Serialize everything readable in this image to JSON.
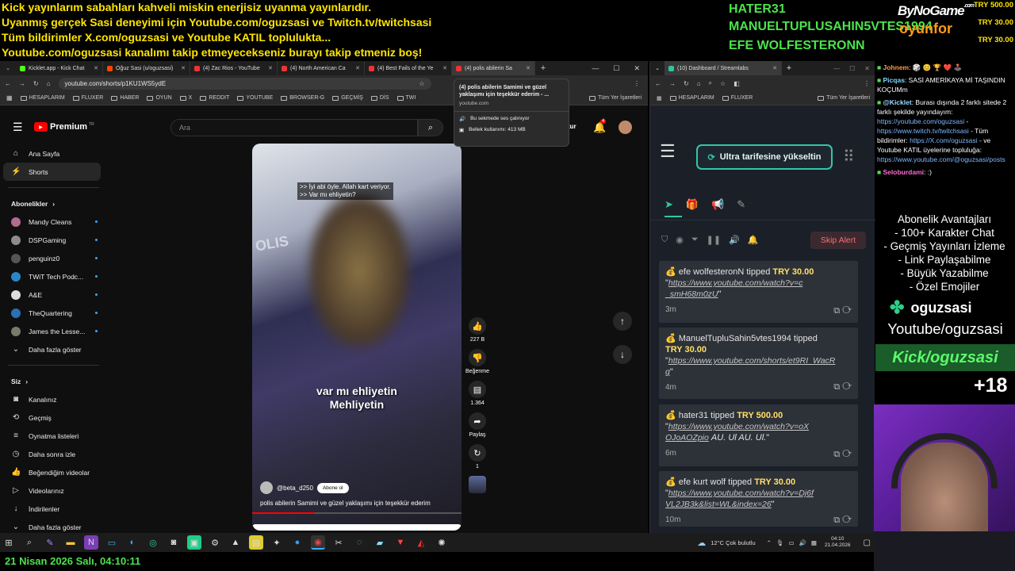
{
  "overlay": {
    "lines": [
      "Kick yayınlarım sabahları kahveli miskin enerjisiz uyanma yayınlarıdır.",
      "Uyanmış gerçek Sasi deneyimi için Youtube.com/oguzsasi ve Twitch.tv/twitchsasi",
      "Tüm bildirimler X.com/oguzsasi ve Youtube KATIL toplulukta...",
      "Youtube.com/oguzsasi kanalımı takip etmeyecekseniz burayı takip etmeniz boş!"
    ],
    "donors": [
      "HATER31",
      "MANUELTUPLUSAHIN5VTES1994",
      "EFE WOLFESTERONN"
    ],
    "logo_main": "ByNoGame",
    "logo_com": ".com",
    "logo_sub": "oyunfor",
    "amounts": [
      "TRY 500.00",
      "TRY 30.00",
      "TRY 30.00"
    ],
    "datetime": "21 Nisan 2026 Salı, 04:10:11",
    "age_badge": "+18"
  },
  "browser_left": {
    "tabs": [
      "Kicklet.app - Kick Chat",
      "Oğuz Sasi (u/oguzsasi)",
      "(4) Zac Rios - YouTube",
      "(4) North American Ca",
      "(4) Best Fails of the Ye",
      "(4) polis abilerin Sa"
    ],
    "url": "youtube.com/shorts/p1KU1WS5ydE",
    "bookmarks": [
      "HESAPLARIM",
      "FLUXER",
      "HABER",
      "OYUN",
      "X",
      "REDDIT",
      "YOUTUBE",
      "BROWSER-G",
      "GEÇMİŞ",
      "DİS",
      "TWI"
    ],
    "all_bookmarks": "Tüm Yer İşaretleri",
    "tooltip": {
      "title": "(4) polis abilerin Samimi ve güzel yaklaşımı için teşekkür ederim - ...",
      "domain": "youtube.com",
      "audio": "Bu sekmede ses çalınıyor",
      "memory": "Bellek kullanımı: 413 MB"
    }
  },
  "youtube": {
    "logo": "Premium",
    "logo_badge": "TR",
    "search_placeholder": "Ara",
    "create_label": "tur",
    "notif_count": "4",
    "nav": [
      "Ana Sayfa",
      "Shorts"
    ],
    "subs_heading": "Abonelikler",
    "subs": [
      "Mandy Cleans",
      "DSPGaming",
      "penguinz0",
      "TWiT Tech Podc...",
      "A&E",
      "TheQuartering",
      "James the Lesse..."
    ],
    "more": "Daha fazla göster",
    "you_heading": "Siz",
    "you_items": [
      "Kanalınız",
      "Geçmiş",
      "Oynatma listeleri",
      "Daha sonra izle",
      "Beğendiğim videolar",
      "Videolarınız",
      "İndirilenler"
    ],
    "more2": "Daha fazla göster",
    "short": {
      "cap1": ">> İyi abi öyle. Allah kart veriyor.",
      "cap2": ">> Var mı ehliyetin?",
      "sub1": "var mı ehliyetin",
      "sub2": "Mehliyetin",
      "channel": "@beta_d250",
      "subscribe": "Abone ol",
      "title": "polis abilerin Samimi ve güzel yaklaşımı için teşekkür ederim",
      "likes": "227 B",
      "dislike": "Beğenme",
      "comments": "1.364",
      "share": "Paylaş",
      "remix": "1"
    }
  },
  "browser_right": {
    "tab": "(10) Dashboard / Streamlabs",
    "bookmarks": [
      "HESAPLARIM",
      "FLUXER"
    ],
    "all_bookmarks": "Tüm Yer İşaretleri",
    "upgrade": "Ultra tarifesine yükseltin",
    "skip_alert": "Skip Alert",
    "alerts": [
      {
        "name": "efe wolfesteronN",
        "verb": "tipped",
        "amount": "TRY 30.00",
        "link": "https://www.youtube.com/watch?v=c_smH68m0zU",
        "msg": "",
        "time": "3m"
      },
      {
        "name": "ManuelTupluSahin5vtes1994",
        "verb": "tipped",
        "amount": "TRY 30.00",
        "link": "https://www.youtube.com/shorts/et9RI_WacRg",
        "msg": "",
        "time": "4m"
      },
      {
        "name": "hater31",
        "verb": "tipped",
        "amount": "TRY 500.00",
        "link": "https://www.youtube.com/watch?v=oXOJoAOZpio",
        "msg": "AU. Ul AU. Ul.",
        "time": "6m"
      },
      {
        "name": "efe kurt wolf",
        "verb": "tipped",
        "amount": "TRY 30.00",
        "link": "https://www.youtube.com/watch?v=Dj6fVL2JB3k&list=WL&index=26",
        "msg": "",
        "time": "10m"
      }
    ]
  },
  "chat": {
    "messages": [
      {
        "user": "Johnem",
        "text": ": 🎲 😊 🏆 ❤️ 🕹️"
      },
      {
        "user": "Picqas",
        "text": ": SASİ AMERİKAYA Mİ TAŞINDIN KOÇUMm"
      },
      {
        "user": "@Kicklet",
        "text": ": Burası dışında 2 farklı sitede 2 farklı şekilde yayındayım:"
      },
      {
        "user": "Seloburdami",
        "text": ": :)"
      }
    ],
    "links": [
      "https://youtube.com/oguzsasi",
      "https://www.twitch.tv/twitchsasi",
      "https://X.com/oguzsasi",
      "https://www.youtube.com/@oguzsasi/posts"
    ],
    "bildirim": "- Tüm bildirimler:",
    "katil": "- ve Youtube KATIL üyelerine topluluğa:"
  },
  "perks": {
    "title": "Abonelik Avantajları",
    "items": [
      "- 100+ Karakter Chat",
      "- Geçmiş Yayınları İzleme",
      "- Link Paylaşabilme",
      "- Büyük Yazabilme",
      "- Özel Emojiler"
    ]
  },
  "socials": {
    "kick_name": "oguzsasi",
    "youtube": "Youtube/oguzsasi",
    "kick": "Kick/oguzsasi"
  },
  "taskbar": {
    "weather": "12°C  Çok bulutlu",
    "time": "04:10",
    "date": "21.04.2026"
  }
}
